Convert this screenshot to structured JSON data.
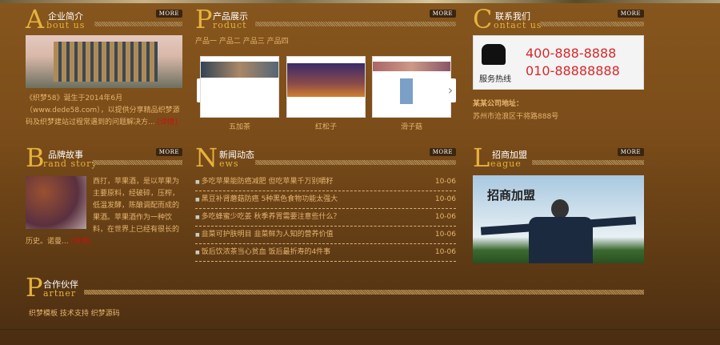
{
  "about": {
    "letter": "A",
    "title": "企业简介",
    "en": "bout us",
    "more": "MORE",
    "text": "《织梦58》诞生于2014年6月（www.dede58.com），以提供分享精品织梦源码及织梦建站过程常遇到的问题解决方...",
    "detail": "[详情]"
  },
  "product": {
    "letter": "P",
    "title": "产品展示",
    "en": "roduct",
    "more": "MORE",
    "categories": [
      "产品一",
      "产品二",
      "产品三",
      "产品四"
    ],
    "items": [
      {
        "name": "五加茶"
      },
      {
        "name": "红松子"
      },
      {
        "name": "滑子菇"
      }
    ],
    "prev": "‹",
    "next": "›"
  },
  "contact": {
    "letter": "C",
    "title": "联系我们",
    "en": "ontact us",
    "more": "MORE",
    "hotline_label": "服务热线",
    "phone1": "400-888-8888",
    "phone2": "010-88888888",
    "address_label": "某某公司地址：",
    "address": "苏州市沧浪区干将路888号"
  },
  "brand": {
    "letter": "B",
    "title": "品牌故事",
    "en": "rand story",
    "more": "MORE",
    "text_side": "西打，苹果酒，是以苹果为主要原料，经破碎，压榨，低温发酵，陈酿调配而成的果酒。苹果酒作为一种饮料，在世界上已经有很长的",
    "text_bottom": "历史。诺曼...",
    "detail": "[详情]"
  },
  "news": {
    "letter": "N",
    "title": "新闻动态",
    "en": "ews",
    "more": "MORE",
    "items": [
      {
        "title": "多吃苹果能防癌减肥 但吃苹果千万别嚼籽",
        "date": "10-06"
      },
      {
        "title": "黑豆补肾蘑菇防癌 5种黑色食物功能太强大",
        "date": "10-06"
      },
      {
        "title": "多吃蜂蜜少吃姜 秋季养胃需要注意些什么？",
        "date": "10-06"
      },
      {
        "title": "韭菜可护肤明目 韭菜鲜为人知的营养价值",
        "date": "10-06"
      },
      {
        "title": "饭后饮浓茶当心贫血 饭后最折寿的4件事",
        "date": "10-06"
      }
    ]
  },
  "league": {
    "letter": "L",
    "title": "招商加盟",
    "en": "eague",
    "more": "MORE",
    "banner_text": "招商加盟"
  },
  "partner": {
    "letter": "P",
    "title": "合作伙伴",
    "en": "artner",
    "links": [
      "织梦模板",
      "技术支持",
      "织梦源码"
    ]
  }
}
